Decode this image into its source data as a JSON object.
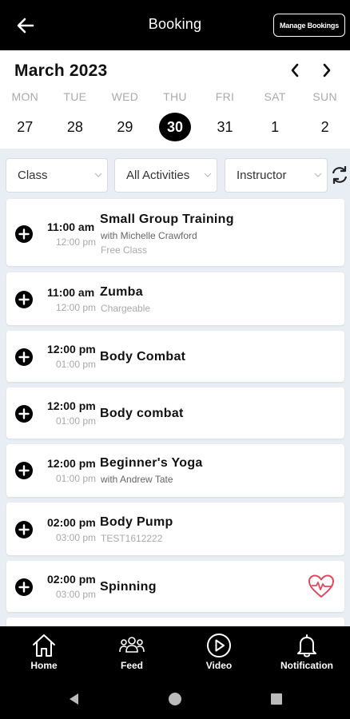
{
  "header": {
    "title": "Booking",
    "manage_label": "Manage Bookings"
  },
  "calendar": {
    "month": "March 2023",
    "days": [
      {
        "name": "MON",
        "num": "27"
      },
      {
        "name": "TUE",
        "num": "28"
      },
      {
        "name": "WED",
        "num": "29"
      },
      {
        "name": "THU",
        "num": "30"
      },
      {
        "name": "FRI",
        "num": "31"
      },
      {
        "name": "SAT",
        "num": "1"
      },
      {
        "name": "SUN",
        "num": "2"
      }
    ],
    "selected_day": "30"
  },
  "filters": {
    "class": "Class",
    "activities": "All Activities",
    "instructor": "Instructor"
  },
  "classes": [
    {
      "start": "11:00 am",
      "end": "12:00 pm",
      "name": "Small Group Training",
      "sub1": "with Michelle Crawford",
      "sub2": "Free Class"
    },
    {
      "start": "11:00 am",
      "end": "12:00 pm",
      "name": "Zumba",
      "sub2": "Chargeable"
    },
    {
      "start": "12:00 pm",
      "end": "01:00 pm",
      "name": "Body Combat"
    },
    {
      "start": "12:00 pm",
      "end": "01:00 pm",
      "name": "Body combat"
    },
    {
      "start": "12:00 pm",
      "end": "01:00 pm",
      "name": "Beginner's Yoga",
      "sub1": "with Andrew Tate"
    },
    {
      "start": "02:00 pm",
      "end": "03:00 pm",
      "name": "Body Pump",
      "sub2": "TEST1612222"
    },
    {
      "start": "02:00 pm",
      "end": "03:00 pm",
      "name": "Spinning",
      "icon": "heart-rate-icon"
    }
  ],
  "bottom_nav": {
    "home": "Home",
    "feed": "Feed",
    "video": "Video",
    "notification": "Notification"
  },
  "colors": {
    "accent": "#000000",
    "background": "#e8eef4",
    "heart": "#e0485e"
  }
}
